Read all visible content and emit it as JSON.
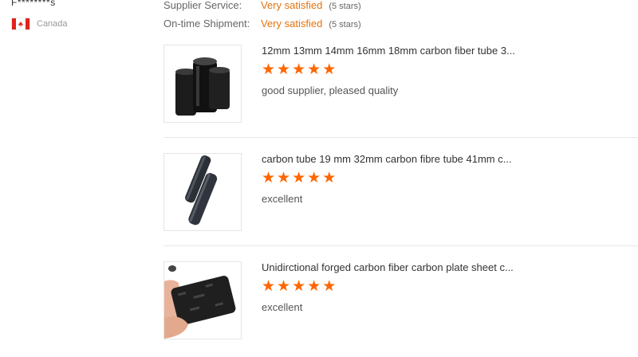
{
  "reviewer": {
    "name": "F********s",
    "country": "Canada",
    "flag_icon": "canada-flag-icon"
  },
  "ratings": [
    {
      "label": "Supplier Service:",
      "value": "Very satisfied",
      "stars_text": "(5 stars)"
    },
    {
      "label": "On-time Shipment:",
      "value": "Very satisfied",
      "stars_text": "(5 stars)"
    }
  ],
  "reviews": [
    {
      "product_title": "12mm 13mm 14mm 16mm 18mm carbon fiber tube 3...",
      "stars": 5,
      "comment": "good supplier, pleased quality"
    },
    {
      "product_title": "carbon tube 19 mm 32mm carbon fibre tube 41mm c...",
      "stars": 5,
      "comment": "excellent"
    },
    {
      "product_title": "Unidirctional forged carbon fiber carbon plate sheet c...",
      "stars": 5,
      "comment": "excellent"
    }
  ],
  "colors": {
    "accent": "#e4730f",
    "star": "#ff6600",
    "flag_red": "#e2231a"
  }
}
